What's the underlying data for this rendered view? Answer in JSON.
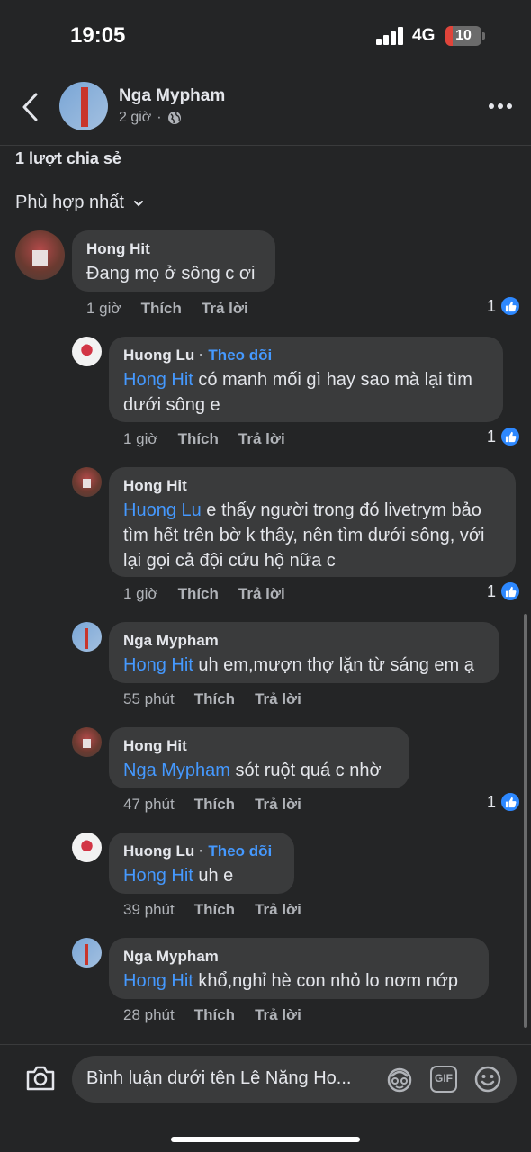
{
  "status_bar": {
    "time": "19:05",
    "network": "4G",
    "battery": "10"
  },
  "header": {
    "name": "Nga Mypham",
    "time": "2 giờ",
    "separator": "·"
  },
  "shares": "1 lượt chia sẻ",
  "sort_label": "Phù hợp nhất",
  "comments": [
    {
      "author": "Hong Hit",
      "follow": "",
      "mention": "",
      "text": "Đang mọ ở sông c ơi",
      "time": "1 giờ",
      "like": "Thích",
      "reply": "Trả lời",
      "like_count": "1"
    },
    {
      "author": "Huong Lu",
      "follow": "Theo dõi",
      "mention": "Hong Hit",
      "text": " có manh mối gì hay sao mà lại tìm dưới sông e",
      "time": "1 giờ",
      "like": "Thích",
      "reply": "Trả lời",
      "like_count": "1"
    },
    {
      "author": "Hong Hit",
      "follow": "",
      "mention": "Huong Lu",
      "text": " e thấy người trong đó livetrym bảo tìm hết trên bờ k thấy, nên tìm dưới sông, với lại gọi cả đội cứu hộ nữa c",
      "time": "1 giờ",
      "like": "Thích",
      "reply": "Trả lời",
      "like_count": "1"
    },
    {
      "author": "Nga Mypham",
      "follow": "",
      "mention": "Hong Hit",
      "text": " uh em,mượn thợ lặn từ sáng em ạ",
      "time": "55 phút",
      "like": "Thích",
      "reply": "Trả lời",
      "like_count": ""
    },
    {
      "author": "Hong Hit",
      "follow": "",
      "mention": "Nga Mypham",
      "text": " sót ruột quá c nhờ",
      "time": "47 phút",
      "like": "Thích",
      "reply": "Trả lời",
      "like_count": "1"
    },
    {
      "author": "Huong Lu",
      "follow": "Theo dõi",
      "mention": "Hong Hit",
      "text": " uh e",
      "time": "39 phút",
      "like": "Thích",
      "reply": "Trả lời",
      "like_count": ""
    },
    {
      "author": "Nga Mypham",
      "follow": "",
      "mention": "Hong Hit",
      "text": " khổ,nghỉ hè con nhỏ lo nơm nớp",
      "time": "28 phút",
      "like": "Thích",
      "reply": "Trả lời",
      "like_count": ""
    }
  ],
  "composer": {
    "placeholder": "Bình luận dưới tên Lê Năng Ho..."
  },
  "colors": {
    "background": "#242526",
    "bubble": "#3a3b3c",
    "link": "#4599ff",
    "like": "#2d88ff"
  },
  "icons": [
    "back-icon",
    "globe-icon",
    "more-icon",
    "chevron-down-icon",
    "like-icon",
    "camera-icon",
    "avatar-sticker-icon",
    "gif-icon",
    "emoji-icon"
  ]
}
